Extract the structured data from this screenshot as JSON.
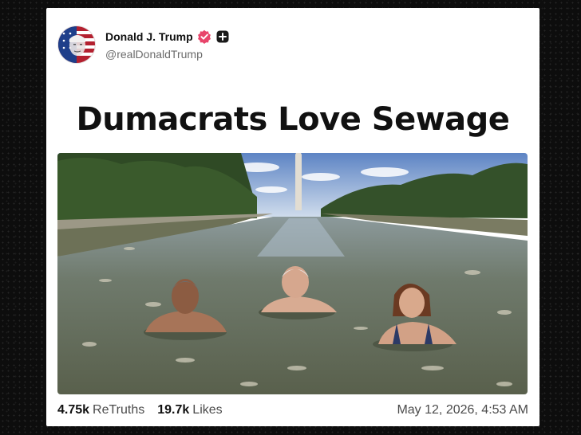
{
  "post": {
    "display_name": "Donald J. Trump",
    "handle": "@realDonaldTrump",
    "headline": "Dumacrats Love Sewage",
    "retruths_count": "4.75k",
    "retruths_label": "ReTruths",
    "likes_count": "19.7k",
    "likes_label": "Likes",
    "timestamp": "May 12, 2026, 4:53 AM"
  },
  "icons": {
    "verified": "verified-badge-icon",
    "follow": "plus-square-icon"
  },
  "colors": {
    "verified_badge": "#e8456b",
    "card_background": "#ffffff",
    "page_background": "#0d0d0d"
  }
}
